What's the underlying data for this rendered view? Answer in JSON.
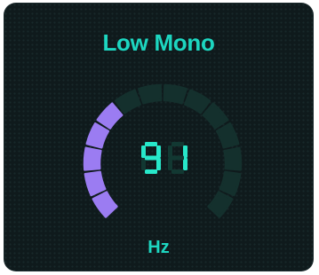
{
  "control": {
    "title": "Low Mono",
    "value": "91",
    "unit": "Hz",
    "level": 0.35,
    "segments_total": 14,
    "colors": {
      "accent": "#1dd6c0",
      "active_segment": "#9b7cf2",
      "inactive_segment": "#14302d",
      "panel": "#0f1a1c",
      "digit_on": "#27e7c9",
      "digit_off": "#123832"
    }
  }
}
